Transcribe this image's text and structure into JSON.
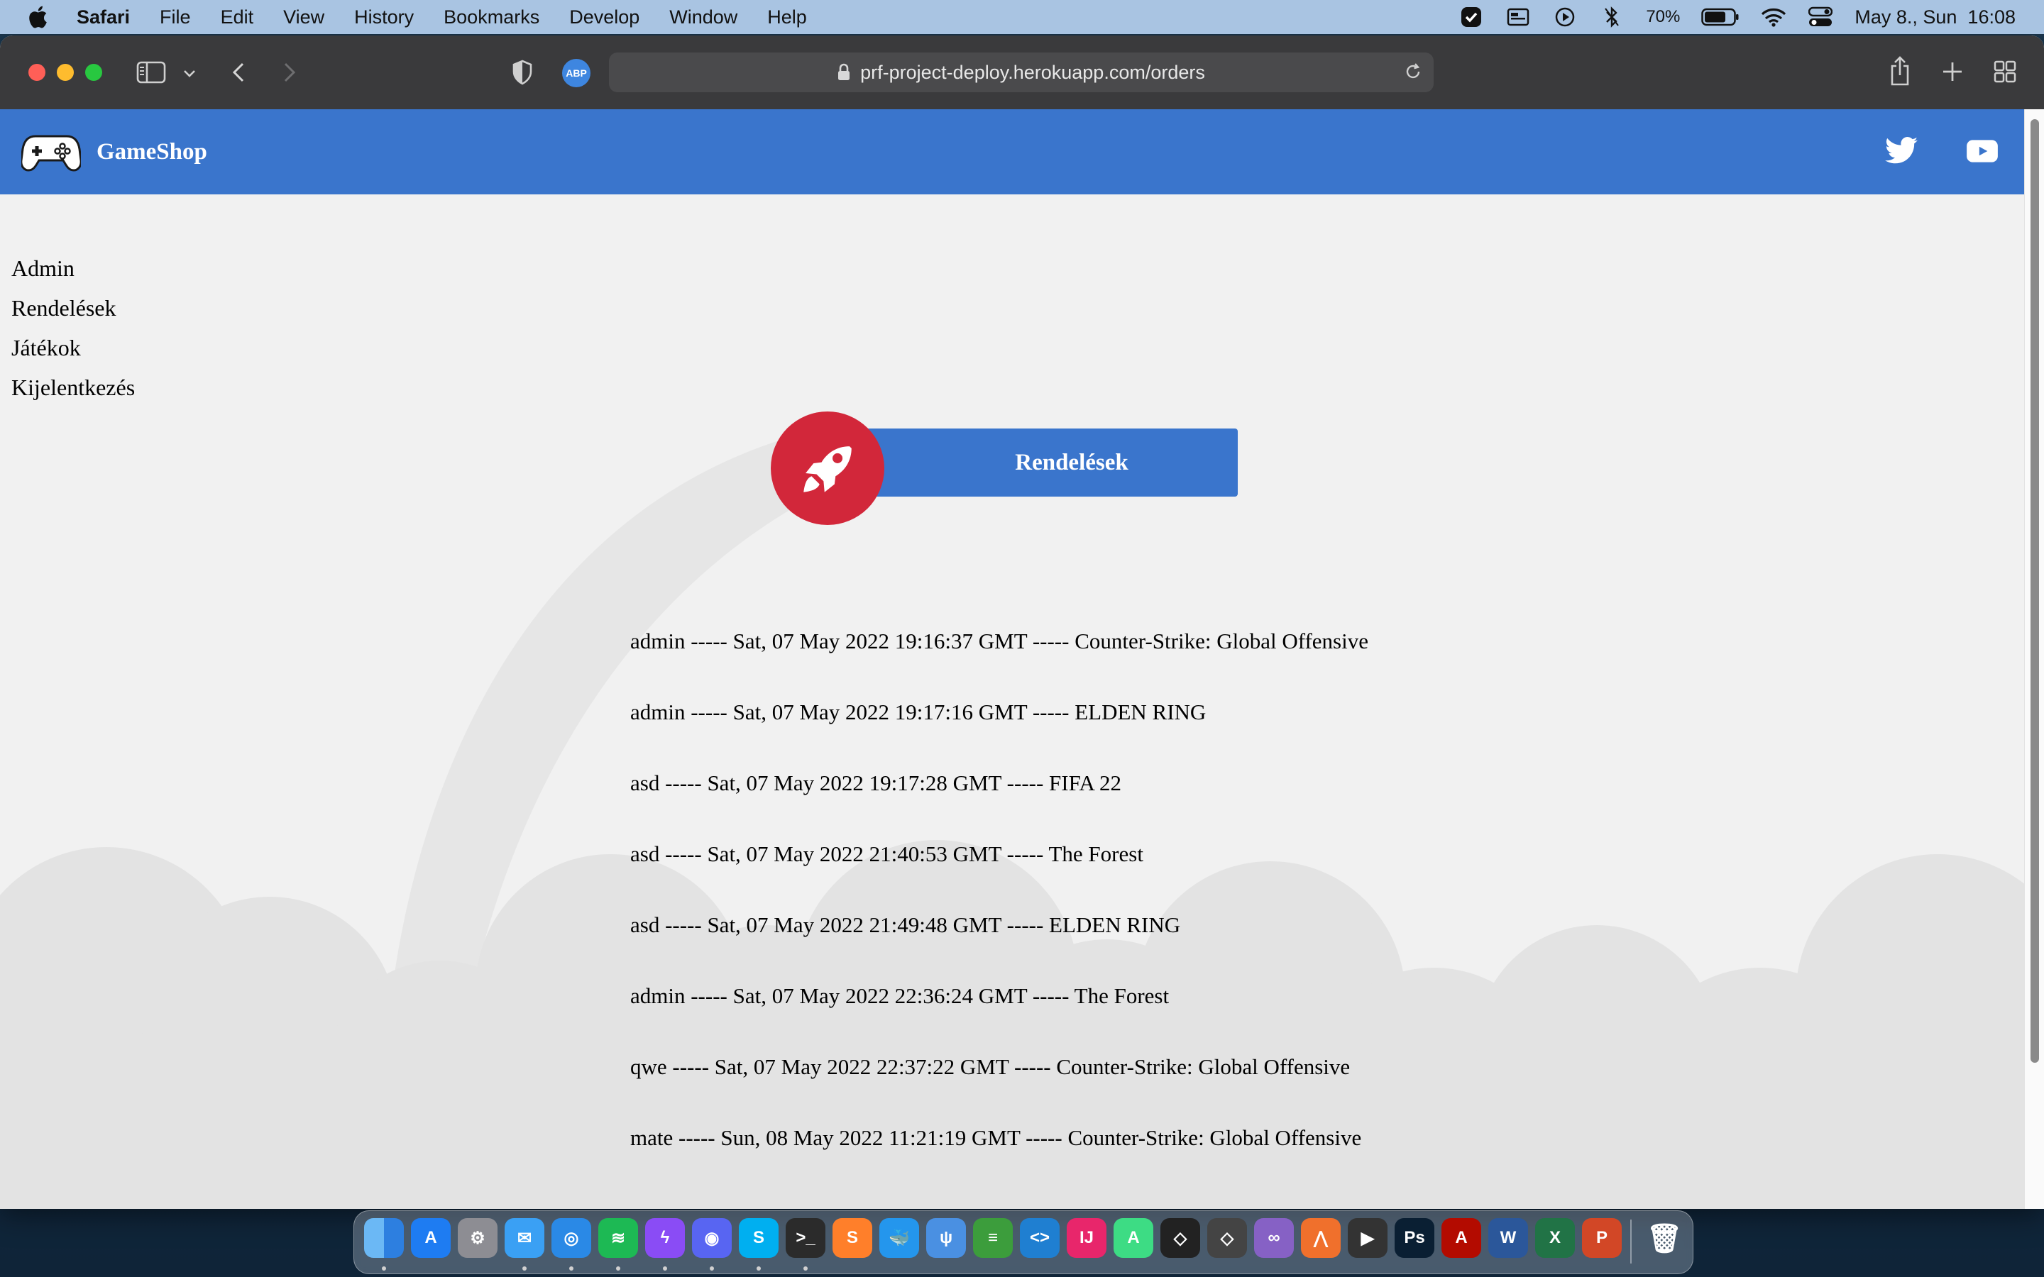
{
  "menubar": {
    "app_name": "Safari",
    "menus": [
      "File",
      "Edit",
      "View",
      "History",
      "Bookmarks",
      "Develop",
      "Window",
      "Help"
    ],
    "battery_percent": "70%",
    "datetime": "May 8., Sun  16:08",
    "status_icons": [
      "checkmark-shield-icon",
      "menu-extra-icon",
      "play-icon",
      "bluetooth-icon",
      "battery-icon",
      "wifi-icon",
      "control-center-icon"
    ]
  },
  "browser": {
    "url": "prf-project-deploy.herokuapp.com/orders",
    "adblock_label": "ABP"
  },
  "site": {
    "brand": "GameShop",
    "accent_color": "#3a75cc",
    "badge_color": "#d2273a",
    "nav": [
      "Admin",
      "Rendelések",
      "Játékok",
      "Kijelentkezés"
    ],
    "page_title": "Rendelések",
    "orders": [
      "admin ----- Sat, 07 May 2022 19:16:37 GMT ----- Counter-Strike: Global Offensive",
      "admin ----- Sat, 07 May 2022 19:17:16 GMT ----- ELDEN RING",
      "asd ----- Sat, 07 May 2022 19:17:28 GMT ----- FIFA 22",
      "asd ----- Sat, 07 May 2022 21:40:53 GMT ----- The Forest",
      "asd ----- Sat, 07 May 2022 21:49:48 GMT ----- ELDEN RING",
      "admin ----- Sat, 07 May 2022 22:36:24 GMT ----- The Forest",
      "qwe ----- Sat, 07 May 2022 22:37:22 GMT ----- Counter-Strike: Global Offensive",
      "mate ----- Sun, 08 May 2022 11:21:19 GMT ----- Counter-Strike: Global Offensive"
    ]
  },
  "dock": {
    "apps": [
      {
        "name": "finder",
        "label": "",
        "color": "#3d8fe0",
        "running": true
      },
      {
        "name": "app-store",
        "label": "A",
        "color": "#1e7cf2",
        "running": false
      },
      {
        "name": "system-preferences",
        "label": "⚙",
        "color": "#8d8d93",
        "running": false
      },
      {
        "name": "mail",
        "label": "✉",
        "color": "#3aa0f4",
        "running": true
      },
      {
        "name": "safari",
        "label": "◎",
        "color": "#2a89e6",
        "running": true
      },
      {
        "name": "spotify",
        "label": "≋",
        "color": "#1db954",
        "running": true
      },
      {
        "name": "messenger",
        "label": "ϟ",
        "color": "#8a4cf5",
        "running": true
      },
      {
        "name": "discord",
        "label": "◉",
        "color": "#5865f2",
        "running": true
      },
      {
        "name": "skype",
        "label": "S",
        "color": "#00aff0",
        "running": true
      },
      {
        "name": "terminal",
        "label": ">_",
        "color": "#2b2b2b",
        "running": true
      },
      {
        "name": "sublime-text",
        "label": "S",
        "color": "#ff7f2a",
        "running": false
      },
      {
        "name": "docker",
        "label": "🐳",
        "color": "#2496ed",
        "running": false
      },
      {
        "name": "fork",
        "label": "ψ",
        "color": "#4a90e2",
        "running": false
      },
      {
        "name": "sourcetree",
        "label": "≡",
        "color": "#3c9d3c",
        "running": false
      },
      {
        "name": "vscode",
        "label": "<>",
        "color": "#1f7fd1",
        "running": false
      },
      {
        "name": "intellij",
        "label": "IJ",
        "color": "#e8266b",
        "running": false
      },
      {
        "name": "android-studio",
        "label": "A",
        "color": "#3ddc84",
        "running": false
      },
      {
        "name": "unity-hub",
        "label": "◇",
        "color": "#222222",
        "running": false
      },
      {
        "name": "unity",
        "label": "◇",
        "color": "#444444",
        "running": false
      },
      {
        "name": "visual-studio",
        "label": "∞",
        "color": "#8661c5",
        "running": false
      },
      {
        "name": "git-app",
        "label": "⋀",
        "color": "#f0702c",
        "running": false
      },
      {
        "name": "final-cut-pro",
        "label": "▶",
        "color": "#333333",
        "running": false
      },
      {
        "name": "photoshop",
        "label": "Ps",
        "color": "#0a1f33",
        "running": false
      },
      {
        "name": "acrobat",
        "label": "A",
        "color": "#b30b00",
        "running": false
      },
      {
        "name": "word",
        "label": "W",
        "color": "#2b579a",
        "running": false
      },
      {
        "name": "excel",
        "label": "X",
        "color": "#217346",
        "running": false
      },
      {
        "name": "powerpoint",
        "label": "P",
        "color": "#d24726",
        "running": false
      }
    ],
    "trash_label": "🗑"
  }
}
